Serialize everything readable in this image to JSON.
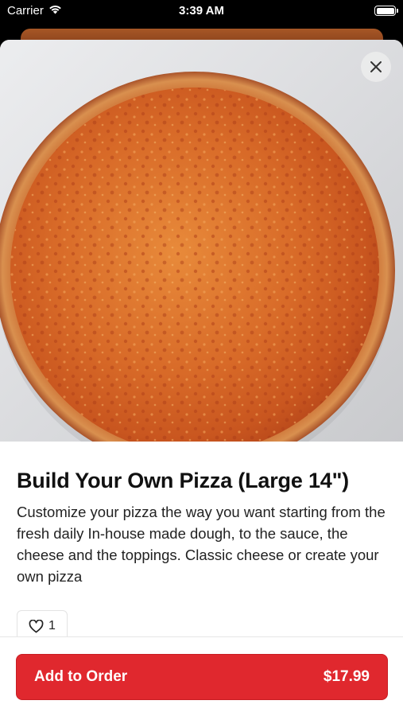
{
  "status_bar": {
    "carrier": "Carrier",
    "time": "3:39 AM"
  },
  "item": {
    "title": "Build Your Own Pizza (Large 14\")",
    "description": "Customize your pizza the way you want starting from the fresh daily In-house made dough, to the sauce, the cheese and the toppings. Classic cheese or create your own pizza",
    "like_count": "1",
    "image_icon": "pizza-photo"
  },
  "footer": {
    "add_label": "Add to Order",
    "price": "$17.99"
  },
  "colors": {
    "accent": "#e0282e"
  }
}
